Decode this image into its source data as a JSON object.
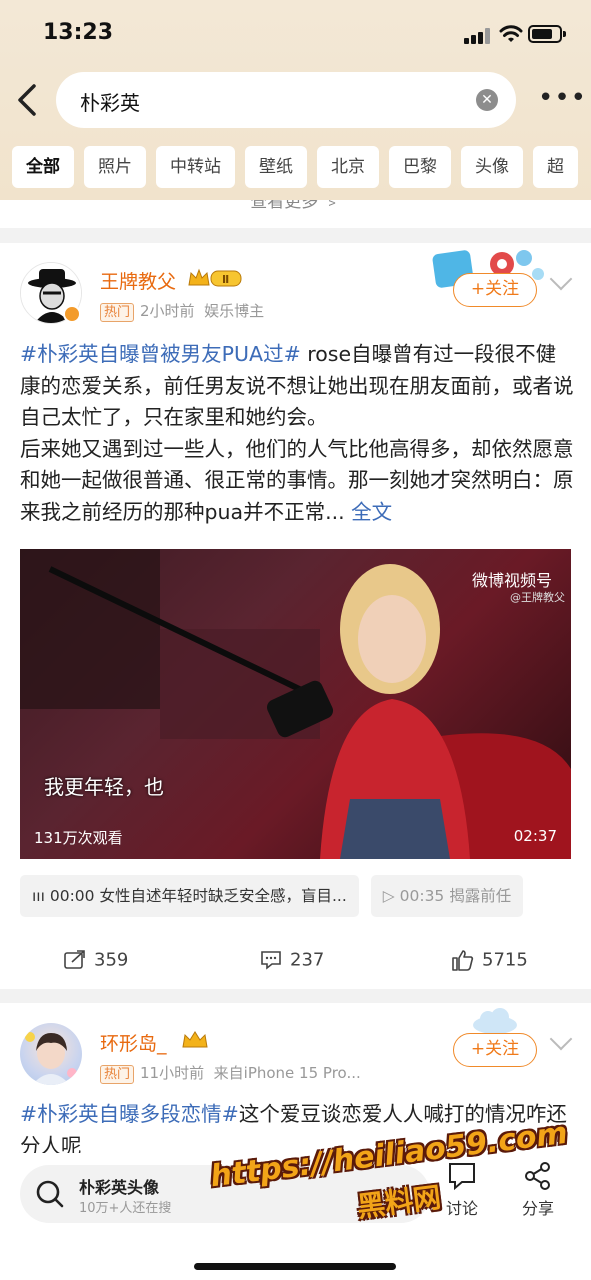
{
  "status": {
    "time": "13:23"
  },
  "search": {
    "query": "朴彩英",
    "clear_icon": "clear-icon",
    "more_icon": "more-icon"
  },
  "tabs": [
    "全部",
    "照片",
    "中转站",
    "壁纸",
    "北京",
    "巴黎",
    "头像",
    "超"
  ],
  "more_link": "查看更多 ﹥",
  "post1": {
    "author": "王牌教父",
    "level": "Ⅱ",
    "hot_tag": "热门",
    "time": "2小时前",
    "role": "娱乐博主",
    "follow": "+关注",
    "topic": "#朴彩英自曝曾被男友PUA过#",
    "text": " rose自曝曾有过一段很不健康的恋爱关系，前任男友说不想让她出现在朋友面前，或者说自己太忙了，只在家里和她约会。",
    "text2": "后来她又遇到过一些人，他们的人气比他高得多，却依然愿意和她一起做很普通、很正常的事情。那一刻她才突然明白：原来我之前经历的那种pua并不正常...",
    "full_link": " 全文",
    "video": {
      "watermark": "微博视频号",
      "watermark_sub": "@王牌教父",
      "caption": "我更年轻，也",
      "views": "131万次观看",
      "duration": "02:37"
    },
    "chapters": [
      {
        "time": "00:00",
        "label": "女性自述年轻时缺乏安全感，盲目..."
      },
      {
        "time": "00:35",
        "label": "揭露前任"
      }
    ],
    "reposts": "359",
    "comments": "237",
    "likes": "5715"
  },
  "post2": {
    "author": "环形岛_",
    "hot_tag": "热门",
    "time": "11小时前",
    "source": "来自iPhone 15 Pro...",
    "follow": "+关注",
    "topic": "#朴彩英自曝多段恋情#",
    "text": "这个爱豆谈恋爱人人喊打的情况咋还分人呢"
  },
  "bottom": {
    "hot_title": "朴彩英头像",
    "hot_sub": "10万+人还在搜",
    "comment_label": "讨论",
    "share_label": "分享"
  },
  "watermark": {
    "url": "https://heiliao59.com",
    "name": "黑料网"
  },
  "colors": {
    "accent": "#f07a1a",
    "link": "#3d6cb8",
    "header_bg": "#f3e8d6"
  }
}
